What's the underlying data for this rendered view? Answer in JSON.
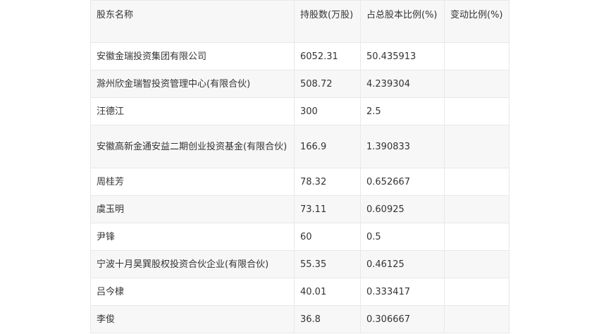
{
  "table": {
    "headers": [
      "股东名称",
      "持股数(万股)",
      "占总股本比例(%)",
      "变动比例(%)"
    ],
    "rows": [
      {
        "name": "安徽金瑞投资集团有限公司",
        "shares": "6052.31",
        "ratio": "50.435913",
        "change": ""
      },
      {
        "name": "滁州欣金瑞智投资管理中心(有限合伙)",
        "shares": "508.72",
        "ratio": "4.239304",
        "change": ""
      },
      {
        "name": "汪德江",
        "shares": "300",
        "ratio": "2.5",
        "change": ""
      },
      {
        "name": "安徽高新金通安益二期创业投资基金(有限合伙)",
        "shares": "166.9",
        "ratio": "1.390833",
        "change": ""
      },
      {
        "name": "周桂芳",
        "shares": "78.32",
        "ratio": "0.652667",
        "change": ""
      },
      {
        "name": "虞玉明",
        "shares": "73.11",
        "ratio": "0.60925",
        "change": ""
      },
      {
        "name": "尹锋",
        "shares": "60",
        "ratio": "0.5",
        "change": ""
      },
      {
        "name": "宁波十月昊巽股权投资合伙企业(有限合伙)",
        "shares": "55.35",
        "ratio": "0.46125",
        "change": ""
      },
      {
        "name": "吕今棣",
        "shares": "40.01",
        "ratio": "0.333417",
        "change": ""
      },
      {
        "name": "李俊",
        "shares": "36.8",
        "ratio": "0.306667",
        "change": ""
      }
    ]
  }
}
